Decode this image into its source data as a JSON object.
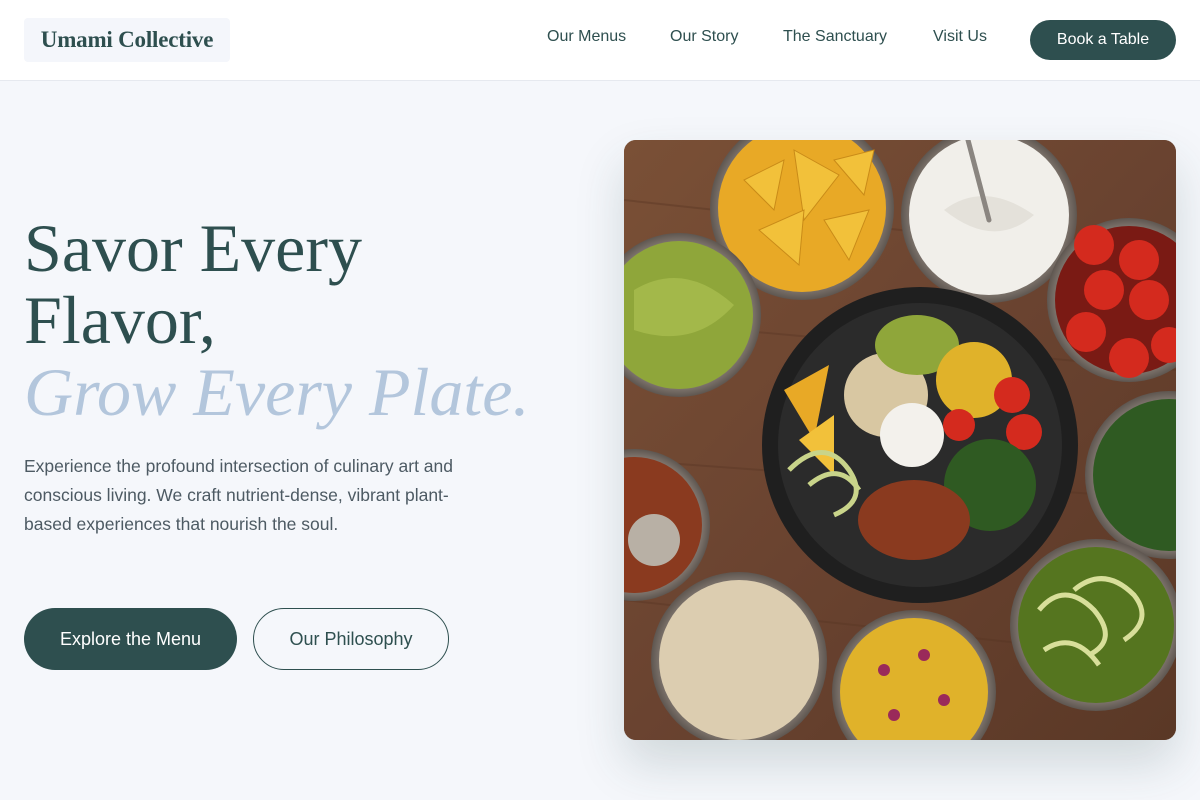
{
  "header": {
    "brand": "Umami Collective",
    "nav": [
      "Our Menus",
      "Our Story",
      "The Sanctuary",
      "Visit Us"
    ],
    "cta": "Book a Table"
  },
  "hero": {
    "title_line1": "Savor Every",
    "title_line2": "Flavor,",
    "title_accent": "Grow Every Plate.",
    "description": "Experience the profound intersection of culinary art and conscious living. We craft nutrient-dense, vibrant plant-based experiences that nourish the soul.",
    "primary_button": "Explore the Menu",
    "secondary_button": "Our Philosophy"
  },
  "colors": {
    "brand": "#2e4f4f",
    "accent": "#b3c6dc",
    "background": "#f5f7fb",
    "text_muted": "#4d5a63"
  },
  "image": {
    "subject": "overhead-bowls-plant-based-spread",
    "items": [
      "tortilla-chips",
      "sour-cream",
      "cherry-tomatoes",
      "guacamole",
      "grain-bowl",
      "kale",
      "beans",
      "rice",
      "corn-salsa",
      "zucchini-noodles"
    ]
  }
}
